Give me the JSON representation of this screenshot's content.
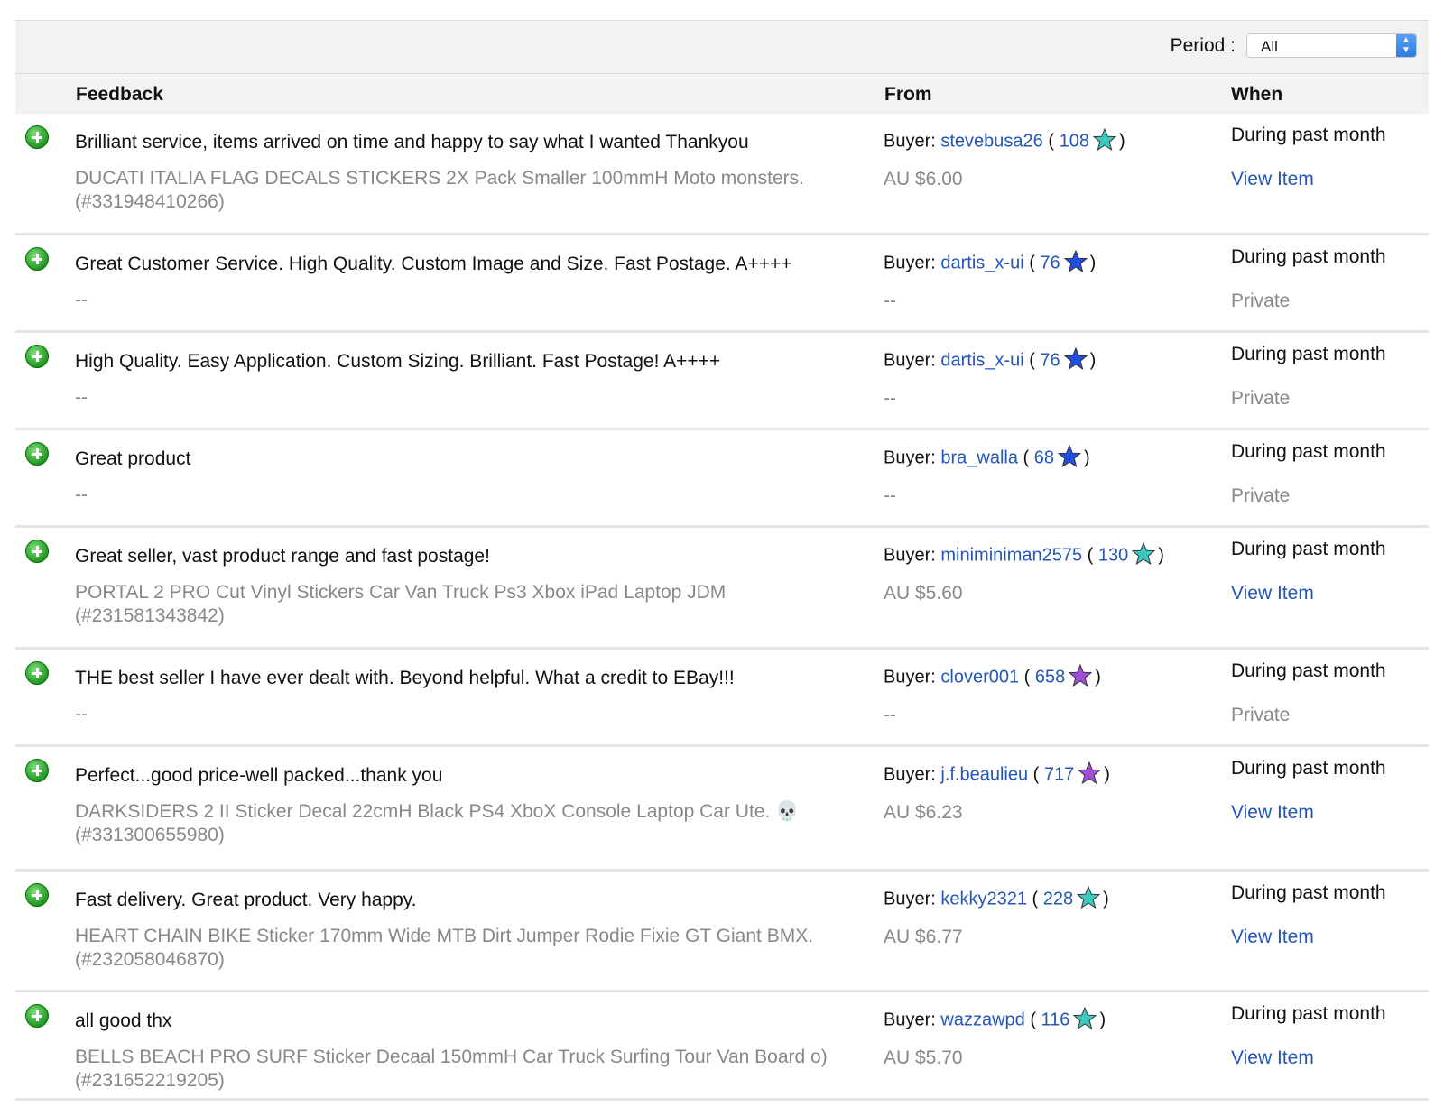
{
  "filter": {
    "period_label": "Period :",
    "period_value": "All"
  },
  "columns": {
    "feedback": "Feedback",
    "from": "From",
    "when": "When"
  },
  "colors": {
    "link": "#2456b8",
    "muted": "#888888",
    "positive": "#1f9a1f"
  },
  "rows": [
    {
      "comment": "Brilliant service, items arrived on time and happy to say what I wanted Thankyou",
      "item_line1": "DUCATI ITALIA FLAG DECALS STICKERS 2X Pack Smaller 100mmH Moto monsters.",
      "item_line2": "(#331948410266)",
      "buyer_prefix": "Buyer:",
      "buyer": "stevebusa26",
      "score": "108",
      "star": "turquoise-star-icon",
      "star_color": "#3cc9c0",
      "price": "AU $6.00",
      "when": "During past month",
      "link": "View Item"
    },
    {
      "comment": "Great Customer Service. High Quality. Custom Image and Size. Fast Postage. A++++",
      "item_line1": "--",
      "item_line2": "",
      "buyer_prefix": "Buyer:",
      "buyer": "dartis_x-ui",
      "score": "76",
      "star": "blue-star-icon",
      "star_color": "#1f4fe0",
      "price": "--",
      "when": "During past month",
      "private": "Private"
    },
    {
      "comment": "High Quality. Easy Application. Custom Sizing. Brilliant. Fast Postage! A++++",
      "item_line1": "--",
      "item_line2": "",
      "buyer_prefix": "Buyer:",
      "buyer": "dartis_x-ui",
      "score": "76",
      "star": "blue-star-icon",
      "star_color": "#1f4fe0",
      "price": "--",
      "when": "During past month",
      "private": "Private"
    },
    {
      "comment": "Great product",
      "item_line1": "--",
      "item_line2": "",
      "buyer_prefix": "Buyer:",
      "buyer": "bra_walla",
      "score": "68",
      "star": "blue-star-icon",
      "star_color": "#1f4fe0",
      "price": "--",
      "when": "During past month",
      "private": "Private"
    },
    {
      "comment": "Great seller, vast product range and fast postage!",
      "item_line1": "PORTAL 2 PRO Cut Vinyl Stickers Car Van Truck Ps3 Xbox iPad Laptop JDM",
      "item_line2": "(#231581343842)",
      "buyer_prefix": "Buyer:",
      "buyer": "miniminiman2575",
      "score": "130",
      "star": "turquoise-star-icon",
      "star_color": "#3cc9c0",
      "price": "AU $5.60",
      "when": "During past month",
      "link": "View Item"
    },
    {
      "comment": "THE best seller I have ever dealt with. Beyond helpful. What a credit to EBay!!!",
      "item_line1": "--",
      "item_line2": "",
      "buyer_prefix": "Buyer:",
      "buyer": "clover001",
      "score": "658",
      "star": "purple-star-icon",
      "star_color": "#a04fd6",
      "price": "--",
      "when": "During past month",
      "private": "Private"
    },
    {
      "comment": "Perfect...good price-well packed...thank you",
      "item_line1": "DARKSIDERS 2 II Sticker Decal 22cmH Black PS4 XboX Console Laptop Car Ute. 💀",
      "item_line2": "(#331300655980)",
      "buyer_prefix": "Buyer:",
      "buyer": "j.f.beaulieu",
      "score": "717",
      "star": "purple-star-icon",
      "star_color": "#a04fd6",
      "price": "AU $6.23",
      "when": "During past month",
      "link": "View Item"
    },
    {
      "comment": "Fast delivery. Great product. Very happy.",
      "item_line1": "HEART CHAIN BIKE Sticker 170mm Wide MTB Dirt Jumper Rodie Fixie GT Giant BMX.",
      "item_line2": "(#232058046870)",
      "buyer_prefix": "Buyer:",
      "buyer": "kekky2321",
      "score": "228",
      "star": "turquoise-star-icon",
      "star_color": "#3cc9c0",
      "price": "AU $6.77",
      "when": "During past month",
      "link": "View Item"
    },
    {
      "comment": "all good thx",
      "item_line1": "BELLS BEACH PRO SURF Sticker Decaal 150mmH Car Truck Surfing Tour Van Board o)",
      "item_line2": "(#231652219205)",
      "buyer_prefix": "Buyer:",
      "buyer": "wazzawpd",
      "score": "116",
      "star": "turquoise-star-icon",
      "star_color": "#3cc9c0",
      "price": "AU $5.70",
      "when": "During past month",
      "link": "View Item"
    }
  ]
}
